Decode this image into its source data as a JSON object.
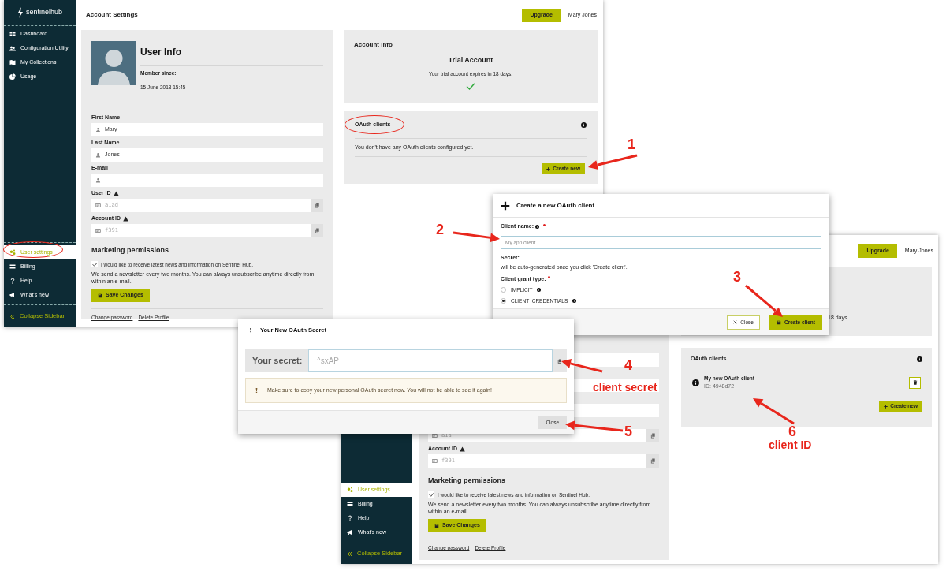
{
  "account_window": {
    "logo": "sentinelhub",
    "title": "Account Settings",
    "upgrade": "Upgrade",
    "user": "Mary Jones",
    "nav_top": [
      {
        "label": "Dashboard",
        "selected": false
      },
      {
        "label": "Configuration Utility",
        "selected": false
      },
      {
        "label": "My Collections",
        "selected": false
      },
      {
        "label": "Usage",
        "selected": false
      }
    ],
    "nav_bottom": [
      {
        "label": "User settings",
        "selected": true
      },
      {
        "label": "Billing",
        "selected": false
      },
      {
        "label": "Help",
        "selected": false
      },
      {
        "label": "What's new",
        "selected": false
      }
    ],
    "collapse": "Collapse Sidebar",
    "user_info": {
      "heading": "User Info",
      "member_label": "Member since:",
      "member_date": "15 June 2018 15:45"
    },
    "fields": [
      {
        "label": "First Name",
        "kind": "person",
        "value": "Mary",
        "warning": false
      },
      {
        "label": "Last Name",
        "kind": "person",
        "value": "Jones",
        "warning": false
      },
      {
        "label": "E-mail",
        "kind": "person",
        "warning": false
      },
      {
        "label": "User ID",
        "kind": "id",
        "value": "a1ad",
        "warning": true
      },
      {
        "label": "Account ID",
        "kind": "id",
        "value": "f391",
        "warning": true
      }
    ],
    "marketing": {
      "heading": "Marketing permissions",
      "consent": "I would like to receive latest news and information on Sentinel Hub.",
      "checked": true,
      "note": "We send a newsletter every two months. You can always unsubscribe anytime directly from within an e-mail.",
      "save": "Save Changes"
    },
    "links": [
      "Change password",
      "Delete Profile"
    ],
    "account_info": {
      "heading": "Account info",
      "plan": "Trial Account",
      "expiry": "Your trial account expires in 18 days."
    },
    "oauth": {
      "heading": "OAuth clients",
      "empty": "You don't have any OAuth clients configured yet.",
      "create": "Create new"
    }
  },
  "updated_window": {
    "upgrade": "Upgrade",
    "user": "Mary Jones",
    "expiry_fragment": "18 days.",
    "nav": [
      {
        "label": "User settings",
        "selected": true
      },
      {
        "label": "Billing",
        "selected": false
      },
      {
        "label": "Help",
        "selected": false
      },
      {
        "label": "What's new",
        "selected": false
      }
    ],
    "collapse": "Collapse Sidebar",
    "fields": [
      {
        "kind": "plain"
      },
      {
        "kind": "plain"
      },
      {
        "kind": "plain"
      },
      {
        "kind": "id",
        "value": "a1a"
      },
      {
        "label": "Account ID",
        "kind": "id",
        "value": "f391",
        "warning": true
      }
    ],
    "marketing": {
      "heading": "Marketing permissions",
      "consent": "I would like to receive latest news and information on Sentinel Hub.",
      "checked": true,
      "note": "We send a newsletter every two months. You can always unsubscribe anytime directly from within an e-mail.",
      "save": "Save Changes"
    },
    "links": [
      "Change password",
      "Delete Profile"
    ],
    "oauth": {
      "heading": "OAuth clients",
      "clients": [
        {
          "name": "My new OAuth client",
          "id": "ID: 4948d72"
        }
      ],
      "create": "Create new"
    }
  },
  "create_dialog": {
    "title": "Create a new OAuth client",
    "name_label": "Client name:",
    "name_placeholder": "My app client",
    "secret_label": "Secret:",
    "secret_note": "will be auto-generated once you click 'Create client'.",
    "grant_label": "Client grant type:",
    "grants": [
      {
        "label": "IMPLICIT",
        "selected": false
      },
      {
        "label": "CLIENT_CREDENTIALS",
        "selected": true
      }
    ],
    "buttons": [
      {
        "label": "Close",
        "kind": "close"
      },
      {
        "label": "Create client",
        "kind": "save"
      }
    ]
  },
  "secret_dialog": {
    "title": "Your New OAuth Secret",
    "secret_label": "Your secret:",
    "secret_value": "^sxAP",
    "warning": "Make sure to copy your new personal OAuth secret now. You will not be able to see it again!",
    "close": "Close"
  },
  "annotations": [
    {
      "number": "1"
    },
    {
      "number": "2"
    },
    {
      "number": "3"
    },
    {
      "number": "4",
      "caption": "client secret"
    },
    {
      "number": "5"
    },
    {
      "number": "6",
      "caption": "client ID"
    }
  ]
}
